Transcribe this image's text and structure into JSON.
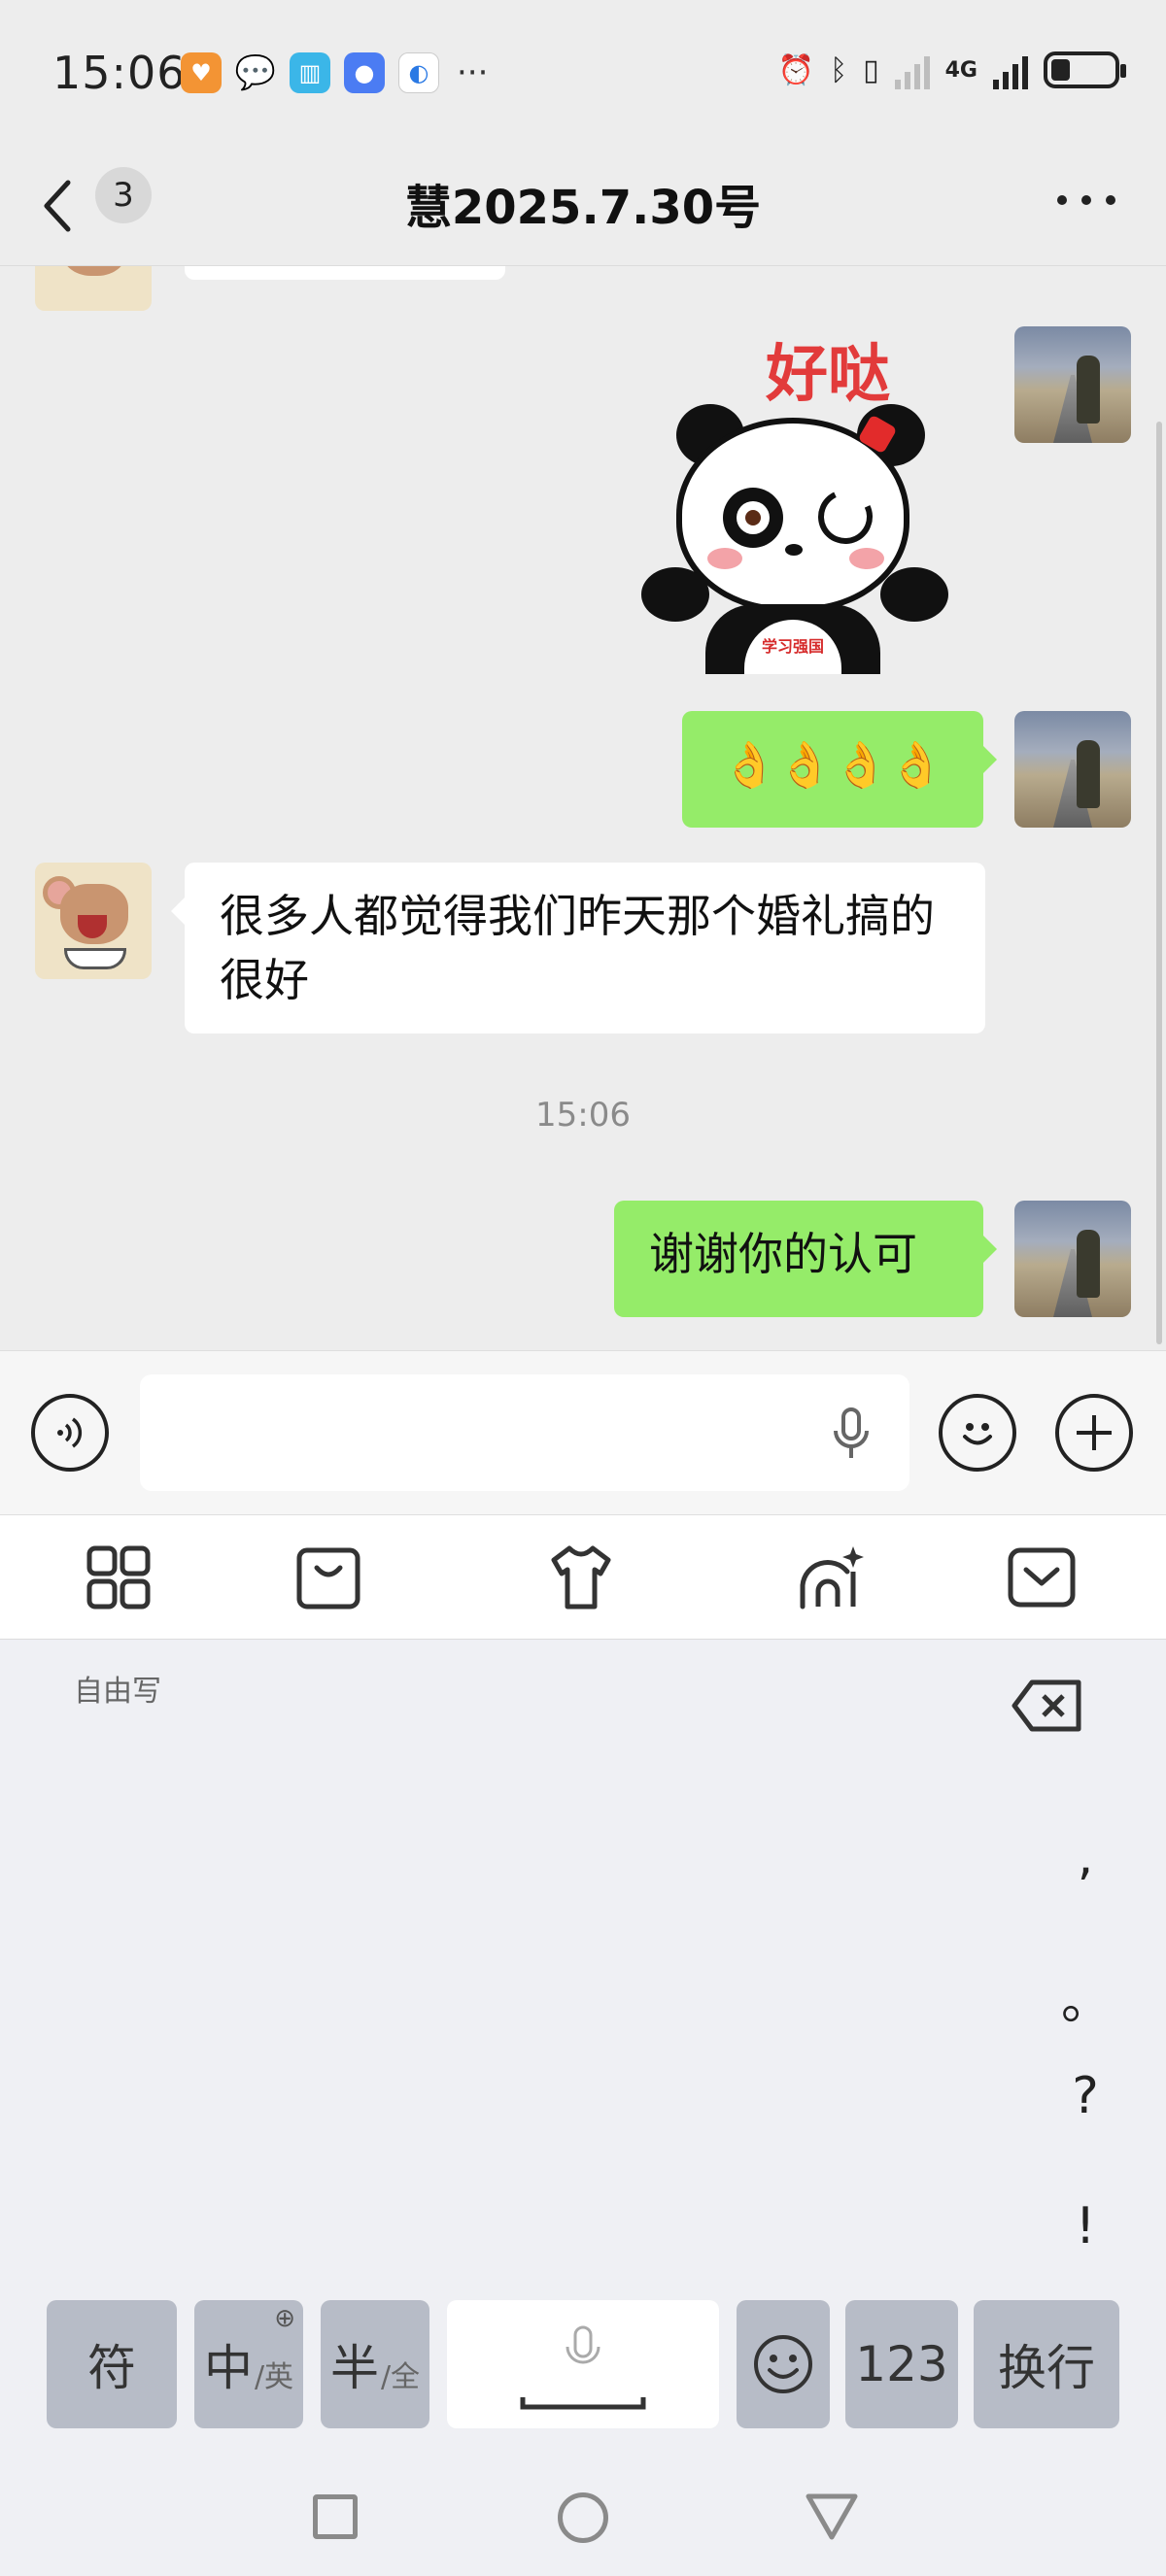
{
  "status_bar": {
    "time": "15:06",
    "overflow_indicator": "···",
    "network_label": "4G",
    "battery_level": 0.3
  },
  "header": {
    "unread_count": "3",
    "title": "慧2025.7.30号"
  },
  "messages": [
    {
      "side": "out",
      "type": "sticker",
      "sticker_text": "好哒",
      "sticker_badge": "学习强国"
    },
    {
      "side": "out",
      "type": "text",
      "text": "👌👌👌👌"
    },
    {
      "side": "in",
      "type": "text",
      "text": "很多人都觉得我们昨天那个婚礼搞的很好"
    },
    {
      "side": "system",
      "type": "time",
      "text": "15:06"
    },
    {
      "side": "out",
      "type": "text",
      "text": "谢谢你的认可"
    }
  ],
  "input": {
    "value": "",
    "placeholder": ""
  },
  "keyboard": {
    "handwriting_label": "自由写",
    "punctuation": [
      ",",
      "。",
      "?",
      "!"
    ],
    "keys": {
      "symbols": "符",
      "lang_main": "中",
      "lang_sub": "/英",
      "width_main": "半",
      "width_sub": "/全",
      "numbers": "123",
      "newline": "换行"
    }
  },
  "colors": {
    "outgoing_bubble": "#95ec69",
    "incoming_bubble": "#ffffff",
    "chat_background": "#ededed",
    "keyboard_background": "#eff0f4"
  }
}
